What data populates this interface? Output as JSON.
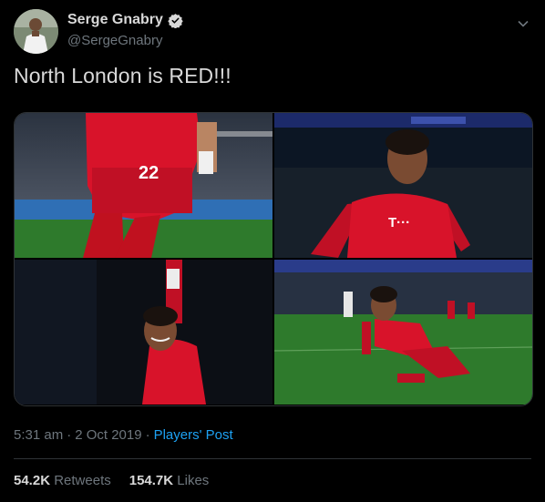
{
  "author": {
    "name": "Serge Gnabry",
    "handle": "@SergeGnabry",
    "verified_icon": "verified-badge-icon"
  },
  "tweet": {
    "text": "North London is RED!!!"
  },
  "media": {
    "jersey_number": "22",
    "sponsor": "T···"
  },
  "meta": {
    "time": "5:31 am",
    "sep1": "·",
    "date": "2 Oct 2019",
    "sep2": "·",
    "source": "Players' Post"
  },
  "stats": {
    "retweets_count": "54.2K",
    "retweets_label": "Retweets",
    "likes_count": "154.7K",
    "likes_label": "Likes"
  },
  "colors": {
    "background": "#000000",
    "link": "#1da1f2",
    "muted": "#6e767d",
    "kit_red": "#d8132a"
  }
}
